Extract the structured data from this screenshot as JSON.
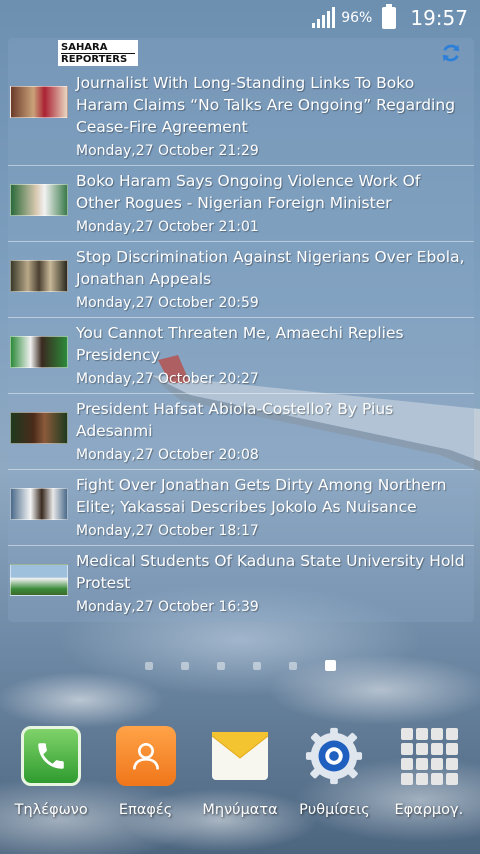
{
  "status_bar": {
    "battery_percent": "96%",
    "time": "19:57"
  },
  "widget": {
    "logo_line1": "SAHARA",
    "logo_line2": "REPORTERS",
    "news": [
      {
        "headline": "Journalist With Long-Standing Links To Boko Haram Claims “No Talks Are Ongoing” Regarding Cease-Fire Agreement",
        "timestamp": "Monday,27 October 21:29"
      },
      {
        "headline": "Boko Haram Says Ongoing Violence Work Of Other Rogues - Nigerian Foreign Minister",
        "timestamp": "Monday,27 October 21:01"
      },
      {
        "headline": "Stop Discrimination Against Nigerians Over Ebola, Jonathan Appeals",
        "timestamp": "Monday,27 October 20:59"
      },
      {
        "headline": "You Cannot Threaten Me, Amaechi Replies Presidency",
        "timestamp": "Monday,27 October 20:27"
      },
      {
        "headline": "President Hafsat Abiola-Costello?  By Pius Adesanmi",
        "timestamp": "Monday,27 October 20:08"
      },
      {
        "headline": "Fight Over Jonathan Gets Dirty Among Northern Elite; Yakassai Describes Jokolo As Nuisance",
        "timestamp": "Monday,27 October 18:17"
      },
      {
        "headline": "Medical Students Of Kaduna State University Hold Protest",
        "timestamp": "Monday,27 October 16:39"
      }
    ]
  },
  "pages": {
    "count": 6,
    "active_index": 5
  },
  "dock": [
    {
      "label": "Τηλέφωνο",
      "icon": "phone-icon"
    },
    {
      "label": "Επαφές",
      "icon": "contacts-icon"
    },
    {
      "label": "Μηνύματα",
      "icon": "messages-icon"
    },
    {
      "label": "Ρυθμίσεις",
      "icon": "settings-icon"
    },
    {
      "label": "Εφαρμογ.",
      "icon": "apps-grid-icon"
    }
  ],
  "colors": {
    "phone_green": "#3aa53a",
    "contacts_orange": "#f58a2a",
    "messages_yellow": "#f4c430",
    "settings_blue": "#1f5fbf"
  }
}
